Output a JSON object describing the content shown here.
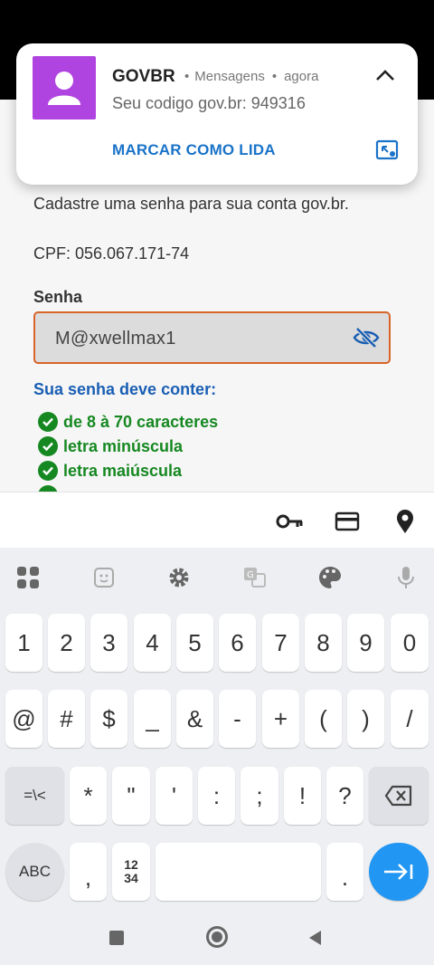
{
  "notification": {
    "app_name": "GOVBR",
    "source": "Mensagens",
    "time": "agora",
    "message": "Seu codigo gov.br: 949316",
    "action_label": "MARCAR COMO LIDA"
  },
  "page": {
    "intro_text": "Cadastre uma senha para sua conta gov.br.",
    "cpf_text": "CPF: 056.067.171-74",
    "password_label": "Senha",
    "password_value": "M@xwellmax1",
    "rules_title": "Sua senha deve conter:",
    "rules": [
      "de 8 à 70 caracteres",
      "letra minúscula",
      "letra maiúscula"
    ]
  },
  "keyboard": {
    "row1": [
      "1",
      "2",
      "3",
      "4",
      "5",
      "6",
      "7",
      "8",
      "9",
      "0"
    ],
    "row2": [
      "@",
      "#",
      "$",
      "_",
      "&",
      "-",
      "+",
      "(",
      ")",
      "/"
    ],
    "row3": [
      "=\\<",
      "*",
      "\"",
      "'",
      ":",
      ";",
      "!",
      "?"
    ],
    "abc_label": "ABC",
    "comma": ",",
    "numpad_label": "12\n34",
    "period": "."
  },
  "colors": {
    "accent_blue": "#1a5fb4",
    "success_green": "#168821",
    "avatar_purple": "#b044e0",
    "input_border": "#d9632a",
    "enter_key": "#2196f3"
  }
}
